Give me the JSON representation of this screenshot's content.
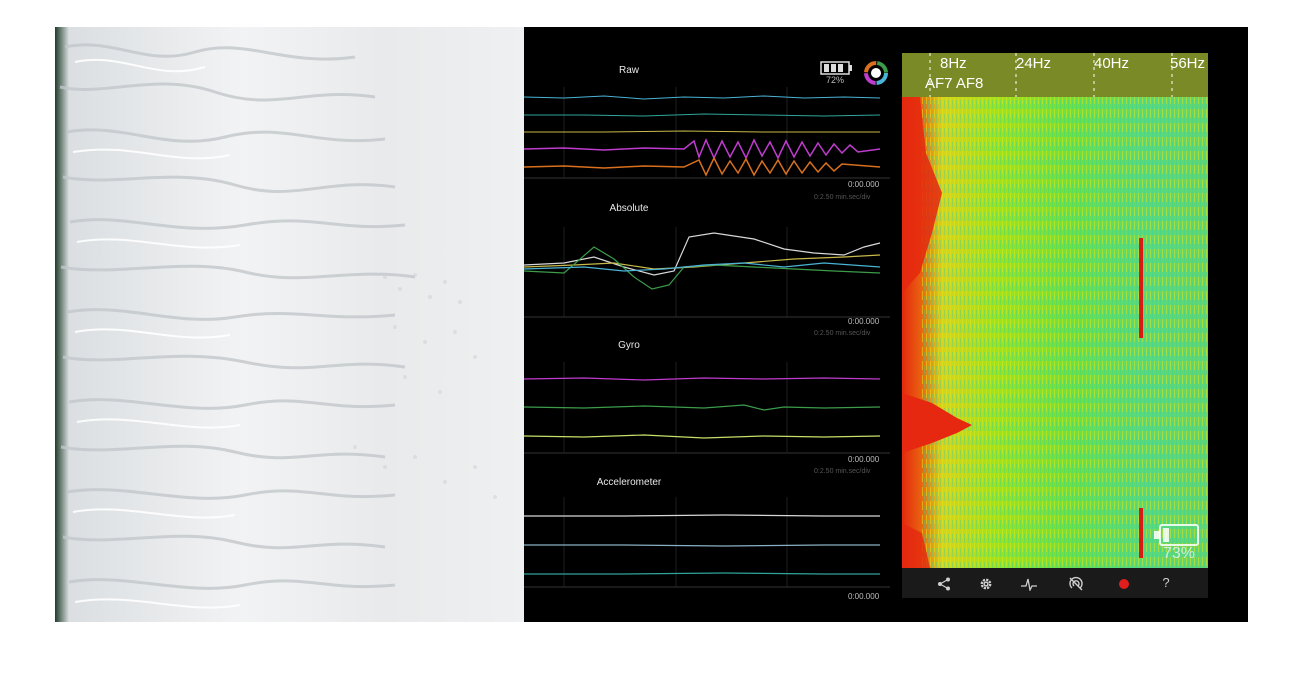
{
  "eeg_panel": {
    "battery_percent": "72%",
    "sections": [
      {
        "title": "Raw",
        "timestamp": "0:00.000",
        "scale": "0:2.50 min.sec/div"
      },
      {
        "title": "Absolute",
        "timestamp": "0:00.000",
        "scale": "0:2.50 min.sec/div"
      },
      {
        "title": "Gyro",
        "timestamp": "0:00.000",
        "scale": "0:2.50 min.sec/div"
      },
      {
        "title": "Accelerometer",
        "timestamp": "0:00.000"
      }
    ],
    "colors": {
      "cyan": "#4ab3d6",
      "teal": "#2fa59a",
      "yellow": "#c8b94a",
      "magenta": "#c03ccf",
      "orange": "#d9701e",
      "green": "#3c9c4a"
    }
  },
  "spectrogram": {
    "freq_labels": [
      "8Hz",
      "24Hz",
      "40Hz",
      "56Hz"
    ],
    "channel_label": "AF7 AF8",
    "battery_percent": "73%",
    "toolbar": [
      "share-icon",
      "settings-gear-icon",
      "pulse-icon",
      "sensor-off-icon",
      "record-icon",
      "help-icon"
    ],
    "help_label": "?"
  }
}
